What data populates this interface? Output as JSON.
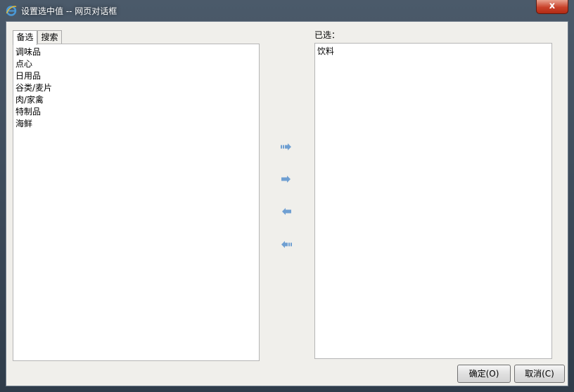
{
  "window": {
    "title": "设置选中值 -- 网页对话框",
    "close_label": "x"
  },
  "tabs": [
    {
      "label": "备选",
      "active": true
    },
    {
      "label": "搜索",
      "active": false
    }
  ],
  "available": {
    "items": [
      "调味品",
      "点心",
      "日用品",
      "谷类/麦片",
      "肉/家禽",
      "特制品",
      "海鲜"
    ]
  },
  "selected": {
    "label": "已选：",
    "items": [
      "饮料"
    ]
  },
  "arrows": [
    {
      "name": "move-all-right-icon"
    },
    {
      "name": "move-right-icon"
    },
    {
      "name": "move-left-icon"
    },
    {
      "name": "move-all-left-icon"
    }
  ],
  "buttons": {
    "ok_label": "确定(O)",
    "cancel_label": "取消(C)"
  },
  "colors": {
    "arrow": "#6f9fd2",
    "client_bg": "#f0efeb",
    "close_red": "#c9422a"
  }
}
